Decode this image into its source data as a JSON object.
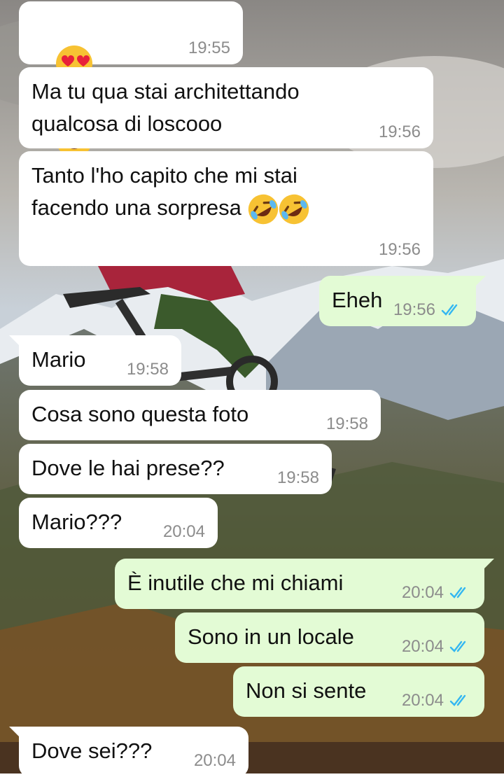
{
  "colors": {
    "incoming_bubble": "#ffffff",
    "outgoing_bubble": "#e3fbd5",
    "timestamp": "#8c8c8c",
    "read_ticks": "#34b7f1"
  },
  "messages": [
    {
      "direction": "in",
      "text": "",
      "emoji": [
        "smiling-face-with-heart-eyes",
        "smiling-face-with-heart-eyes",
        "smiling-face-with-heart-eyes"
      ],
      "time": "19:55"
    },
    {
      "direction": "in",
      "text": "Ma tu qua stai architettando\nqualcosa di loscooo",
      "time": "19:56"
    },
    {
      "direction": "in",
      "text": "Tanto l'ho capito che mi stai\nfacendo una sorpresa ",
      "emoji": [
        "rolling-on-floor-laughing",
        "rolling-on-floor-laughing"
      ],
      "time": "19:56"
    },
    {
      "direction": "out",
      "text": "Eheh",
      "time": "19:56",
      "status": "read"
    },
    {
      "direction": "in",
      "text": "Mario",
      "time": "19:58"
    },
    {
      "direction": "in",
      "text": "Cosa sono questa foto",
      "time": "19:58"
    },
    {
      "direction": "in",
      "text": "Dove le hai prese??",
      "time": "19:58"
    },
    {
      "direction": "in",
      "text": "Mario???",
      "time": "20:04"
    },
    {
      "direction": "out",
      "text": "È inutile che mi chiami",
      "time": "20:04",
      "status": "read"
    },
    {
      "direction": "out",
      "text": "Sono in un locale",
      "time": "20:04",
      "status": "read"
    },
    {
      "direction": "out",
      "text": "Non si sente",
      "time": "20:04",
      "status": "read"
    },
    {
      "direction": "in",
      "text": "Dove sei???",
      "time": "20:04"
    }
  ]
}
